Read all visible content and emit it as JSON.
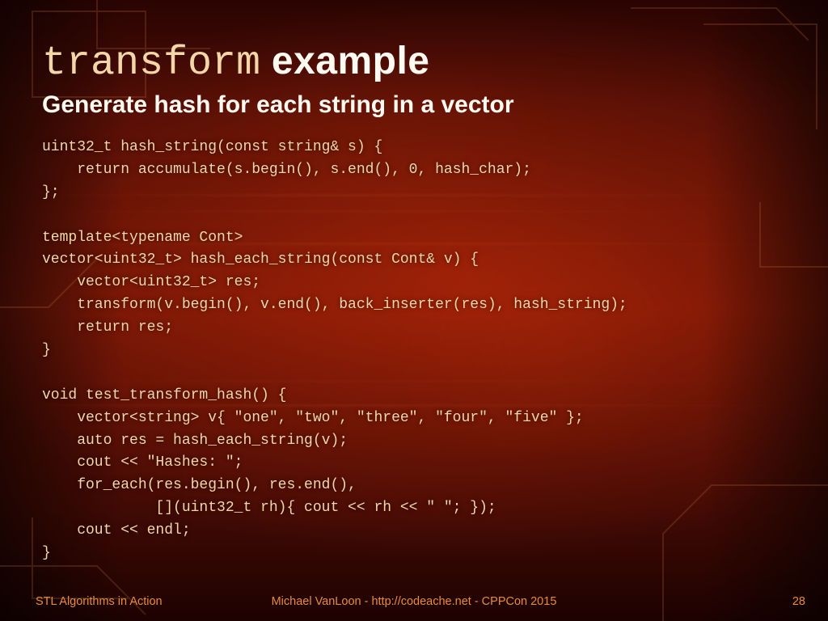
{
  "title": {
    "mono": "transform",
    "rest": " example"
  },
  "subtitle": "Generate hash for each string in a vector",
  "code": "uint32_t hash_string(const string& s) {\n    return accumulate(s.begin(), s.end(), 0, hash_char);\n};\n\ntemplate<typename Cont>\nvector<uint32_t> hash_each_string(const Cont& v) {\n    vector<uint32_t> res;\n    transform(v.begin(), v.end(), back_inserter(res), hash_string);\n    return res;\n}\n\nvoid test_transform_hash() {\n    vector<string> v{ \"one\", \"two\", \"three\", \"four\", \"five\" };\n    auto res = hash_each_string(v);\n    cout << \"Hashes: \";\n    for_each(res.begin(), res.end(),\n             [](uint32_t rh){ cout << rh << \" \"; });\n    cout << endl;\n}",
  "footer": {
    "left": "STL Algorithms in Action",
    "center": "Michael VanLoon - http://codeache.net - CPPCon 2015",
    "right": "28"
  }
}
